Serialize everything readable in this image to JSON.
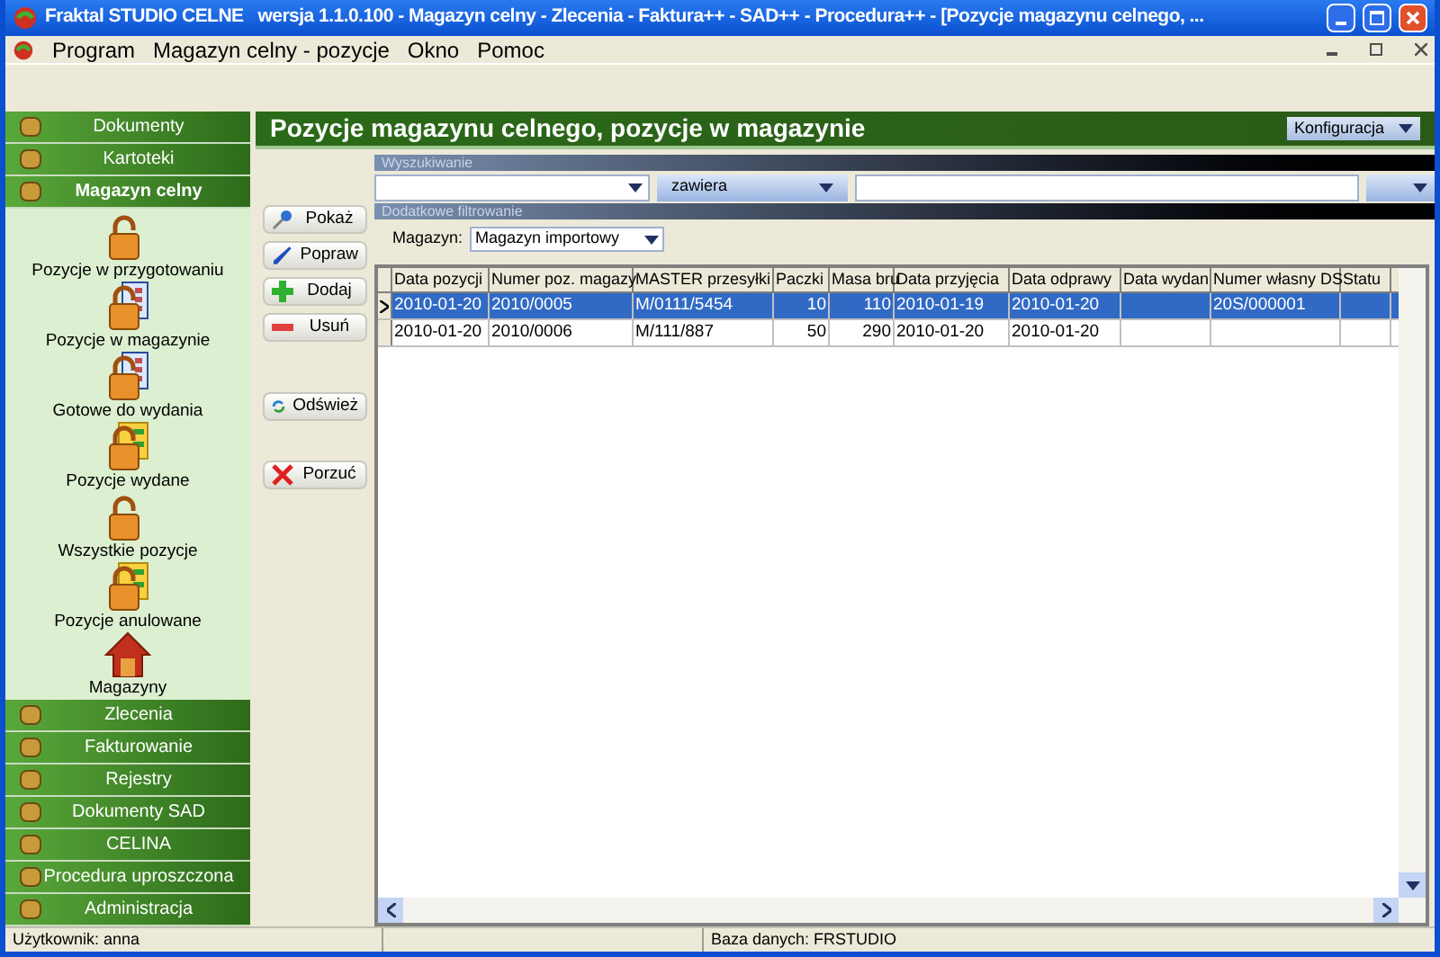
{
  "window": {
    "title": "Fraktal STUDIO CELNE   wersja 1.1.0.100 - Magazyn celny - Zlecenia - Faktura++ - SAD++ - Procedura++ - [Pozycje magazynu celnego, ..."
  },
  "menu": [
    "Program",
    "Magazyn celny - pozycje",
    "Okno",
    "Pomoc"
  ],
  "sidebar": {
    "top": [
      {
        "label": "Dokumenty",
        "selected": false
      },
      {
        "label": "Kartoteki",
        "selected": false
      },
      {
        "label": "Magazyn celny",
        "selected": true
      }
    ],
    "items": [
      {
        "label": "Pozycje w przygotowaniu",
        "kind": "lock"
      },
      {
        "label": "Pozycje w magazynie",
        "kind": "list"
      },
      {
        "label": "Gotowe do wydania",
        "kind": "list"
      },
      {
        "label": "Pozycje wydane",
        "kind": "arrows"
      },
      {
        "label": "Wszystkie pozycje",
        "kind": "lock"
      },
      {
        "label": "Pozycje anulowane",
        "kind": "arrows"
      },
      {
        "label": "Magazyny",
        "kind": "house"
      }
    ],
    "bottom": [
      {
        "label": "Zlecenia",
        "selected": false
      },
      {
        "label": "Fakturowanie",
        "selected": false
      },
      {
        "label": "Rejestry",
        "selected": false
      },
      {
        "label": "Dokumenty SAD",
        "selected": false
      },
      {
        "label": "CELINA",
        "selected": false
      },
      {
        "label": "Procedura uproszczona",
        "selected": false
      },
      {
        "label": "Administracja",
        "selected": false
      }
    ]
  },
  "main": {
    "title": "Pozycje magazynu celnego, pozycje w magazynie",
    "config_button": "Konfiguracja"
  },
  "actions": [
    {
      "label": "Pokaż",
      "kind": "view"
    },
    {
      "label": "Popraw",
      "kind": "edit"
    },
    {
      "label": "Dodaj",
      "kind": "add"
    },
    {
      "label": "Usuń",
      "kind": "remove"
    },
    {
      "label": "Odśwież",
      "kind": "refresh"
    },
    {
      "label": "Porzuć",
      "kind": "cancel"
    }
  ],
  "search": {
    "header": "Wyszukiwanie",
    "operator": "zawiera"
  },
  "filter": {
    "header": "Dodatkowe filtrowanie",
    "label": "Magazyn:",
    "value": "Magazyn importowy"
  },
  "table": {
    "columns": [
      {
        "label": "Data pozycji",
        "kind": "text"
      },
      {
        "label": "Numer poz. magazy",
        "kind": "text"
      },
      {
        "label": "MASTER przesyłki",
        "kind": "text"
      },
      {
        "label": "Paczki",
        "kind": "number"
      },
      {
        "label": "Masa bru",
        "kind": "number"
      },
      {
        "label": "Data przyjęcia",
        "kind": "text"
      },
      {
        "label": "Data odprawy",
        "kind": "text"
      },
      {
        "label": "Data wydan",
        "kind": "text"
      },
      {
        "label": "Numer własny DS",
        "kind": "text"
      },
      {
        "label": "Statu",
        "kind": "text"
      }
    ],
    "rows": [
      {
        "selected": true,
        "cells": [
          "2010-01-20",
          "2010/0005",
          "M/0111/5454",
          "10",
          "110",
          "2010-01-19",
          "2010-01-20",
          "",
          "20S/000001",
          ""
        ]
      },
      {
        "selected": false,
        "cells": [
          "2010-01-20",
          "2010/0006",
          "M/111/887",
          "50",
          "290",
          "2010-01-20",
          "2010-01-20",
          "",
          "",
          ""
        ]
      }
    ]
  },
  "status_bar": {
    "user": "Użytkownik: anna",
    "database": "Baza danych: FRSTUDIO"
  }
}
